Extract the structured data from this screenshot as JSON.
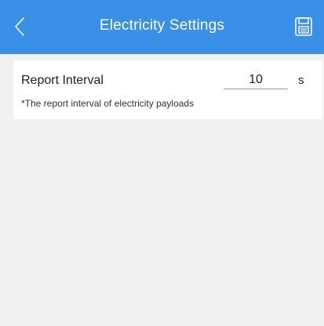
{
  "header": {
    "title": "Electricity Settings",
    "back_icon": "chevron-left-icon",
    "save_icon": "save-icon",
    "background_color": "#3a8fe6"
  },
  "report_interval": {
    "label": "Report Interval",
    "value": "10",
    "unit": "s",
    "hint": "*The report interval of electricity payloads"
  }
}
